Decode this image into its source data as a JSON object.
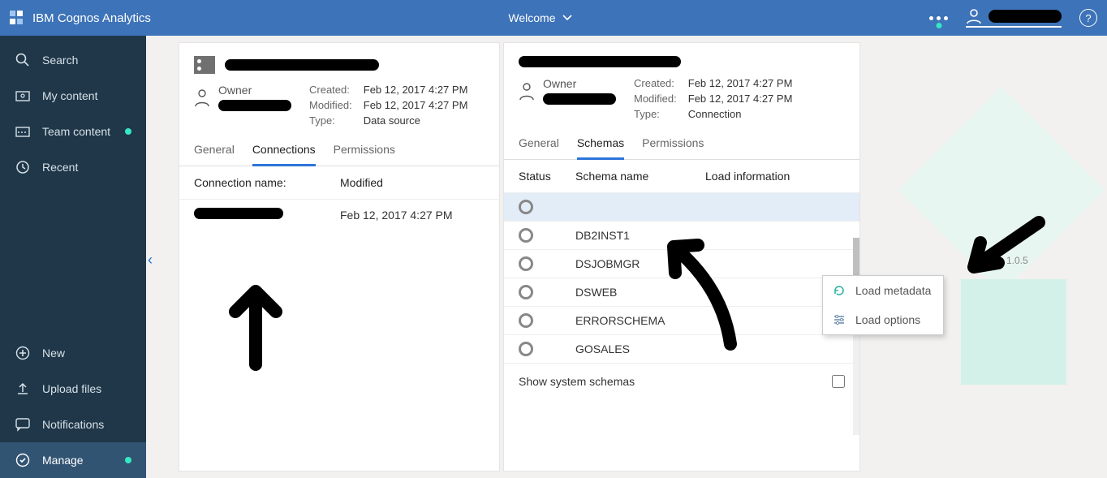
{
  "app": {
    "name": "IBM Cognos Analytics",
    "page_label": "Welcome"
  },
  "leftnav": {
    "search": "Search",
    "my_content": "My content",
    "team_content": "Team content",
    "recent": "Recent",
    "new": "New",
    "upload": "Upload files",
    "notifications": "Notifications",
    "manage": "Manage"
  },
  "panel1": {
    "owner_label": "Owner",
    "created_k": "Created:",
    "created_v": "Feb 12, 2017 4:27 PM",
    "modified_k": "Modified:",
    "modified_v": "Feb 12, 2017 4:27 PM",
    "type_k": "Type:",
    "type_v": "Data source",
    "tabs": {
      "general": "General",
      "connections": "Connections",
      "permissions": "Permissions"
    },
    "col_conn": "Connection name:",
    "col_mod": "Modified",
    "rows": [
      {
        "modified": "Feb 12, 2017 4:27 PM"
      }
    ]
  },
  "panel2": {
    "owner_label": "Owner",
    "created_k": "Created:",
    "created_v": "Feb 12, 2017 4:27 PM",
    "modified_k": "Modified:",
    "modified_v": "Feb 12, 2017 4:27 PM",
    "type_k": "Type:",
    "type_v": "Connection",
    "tabs": {
      "general": "General",
      "schemas": "Schemas",
      "permissions": "Permissions"
    },
    "col_status": "Status",
    "col_schema": "Schema name",
    "col_load": "Load information",
    "schemas": [
      {
        "name": ""
      },
      {
        "name": "DB2INST1"
      },
      {
        "name": "DSJOBMGR"
      },
      {
        "name": "DSWEB"
      },
      {
        "name": "ERRORSCHEMA"
      },
      {
        "name": "GOSALES"
      }
    ],
    "show_system": "Show system schemas"
  },
  "ctx": {
    "load_metadata": "Load metadata",
    "load_options": "Load options"
  },
  "version": "1.0.5"
}
